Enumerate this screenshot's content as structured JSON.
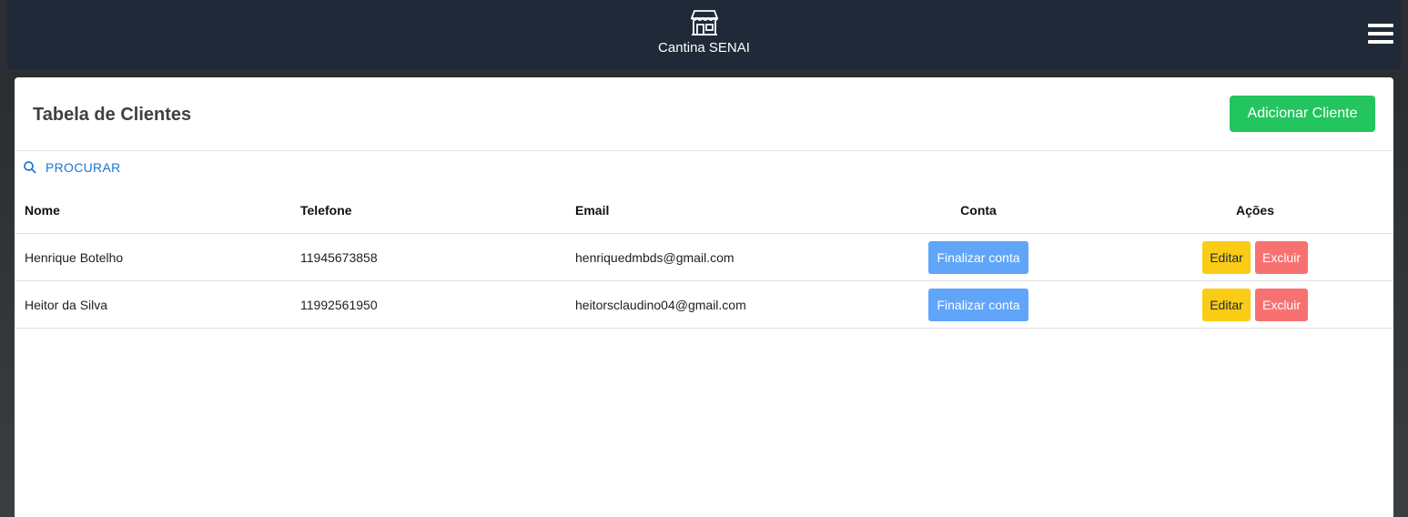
{
  "navbar": {
    "brand_name": "Cantina SENAI",
    "brand_icon": "store-icon",
    "menu_icon": "hamburger-menu-icon"
  },
  "card": {
    "title": "Tabela de Clientes",
    "add_button_label": "Adicionar Cliente",
    "search_label": "PROCURAR",
    "colors": {
      "add": "#22c55e",
      "finalize": "#60a5fa",
      "edit": "#facc15",
      "delete": "#f87171",
      "search": "#1976d2"
    }
  },
  "table": {
    "headers": [
      "Nome",
      "Telefone",
      "Email",
      "Conta",
      "Ações"
    ],
    "rows": [
      {
        "nome": "Henrique Botelho",
        "telefone": "11945673858",
        "email": "henriquedmbds@gmail.com",
        "conta_label": "Finalizar conta",
        "edit_label": "Editar",
        "delete_label": "Excluir"
      },
      {
        "nome": "Heitor da Silva",
        "telefone": "11992561950",
        "email": "heitorsclaudino04@gmail.com",
        "conta_label": "Finalizar conta",
        "edit_label": "Editar",
        "delete_label": "Excluir"
      }
    ]
  }
}
